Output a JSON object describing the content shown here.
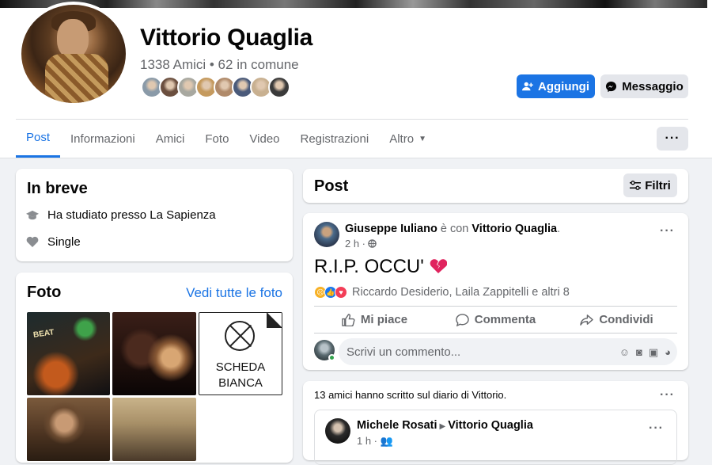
{
  "profile": {
    "name": "Vittorio Quaglia",
    "friends_summary": "1338 Amici • 62 in comune",
    "mutual_friend_avatars": [
      "#8a9aa8",
      "#6b4f3f",
      "#a8a8a0",
      "#c59a5e",
      "#b08a6a",
      "#4a5a7a",
      "#c8b090",
      "#3a3a3a"
    ]
  },
  "actions": {
    "add_label": "Aggiungi",
    "message_label": "Messaggio",
    "more_label": "···"
  },
  "tabs": [
    {
      "label": "Post"
    },
    {
      "label": "Informazioni"
    },
    {
      "label": "Amici"
    },
    {
      "label": "Foto"
    },
    {
      "label": "Video"
    },
    {
      "label": "Registrazioni"
    },
    {
      "label": "Altro"
    }
  ],
  "intro": {
    "title": "In breve",
    "items": [
      {
        "icon": "graduation-cap-icon",
        "text": "Ha studiato presso La Sapienza"
      },
      {
        "icon": "heart-icon",
        "text": "Single"
      }
    ]
  },
  "photos": {
    "title": "Foto",
    "see_all": "Vedi tutte le foto",
    "p1_sign": "BEAT",
    "p3_line1": "SCHEDA",
    "p3_line2": "BIANCA"
  },
  "posts_header": {
    "title": "Post",
    "filter_label": "Filtri"
  },
  "post": {
    "author": "Giuseppe Iuliano",
    "with_text": "è con",
    "tagged": "Vittorio Quaglia",
    "time": "2 h ·",
    "text": "R.I.P. OCCU'",
    "reactions_text": "Riccardo Desiderio, Laila Zappitelli e altri 8",
    "like_label": "Mi piace",
    "comment_label": "Commenta",
    "share_label": "Condividi",
    "comment_placeholder": "Scrivi un commento..."
  },
  "wall": {
    "summary": "13 amici hanno scritto sul diario di Vittorio.",
    "author": "Michele Rosati",
    "target": "Vittorio Quaglia",
    "time": "1 h ·"
  },
  "colors": {
    "accent": "#1b74e4",
    "background": "#f0f2f5",
    "secondary_text": "#65676b"
  }
}
